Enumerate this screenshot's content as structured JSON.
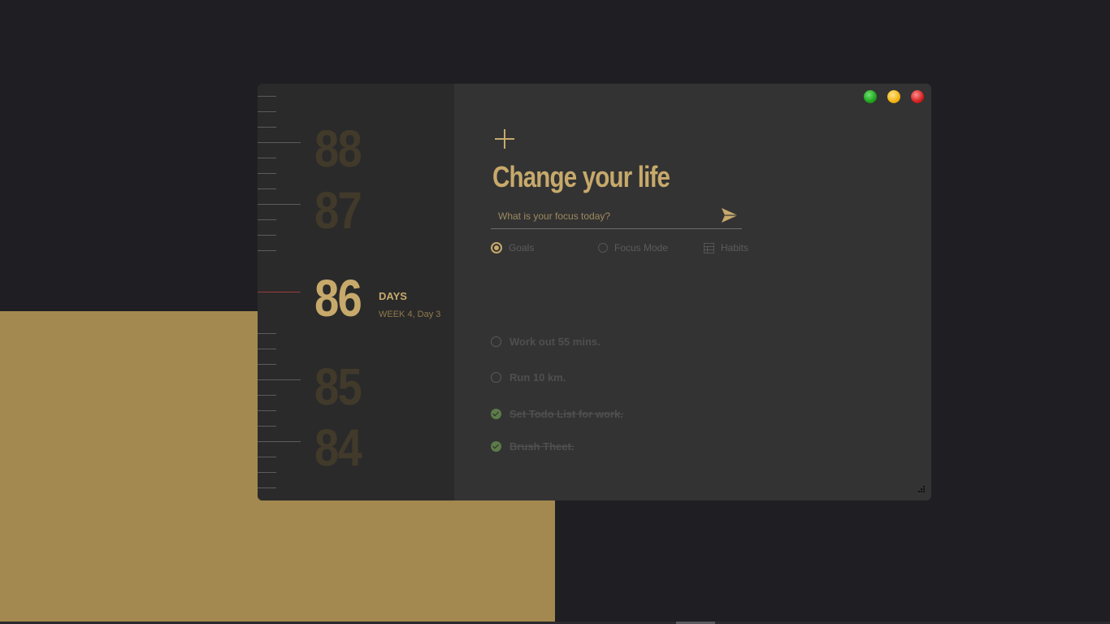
{
  "app": {
    "title": "Change your life",
    "window_controls": [
      "maximize",
      "minimize",
      "close"
    ]
  },
  "countdown": {
    "numbers": [
      "88",
      "87",
      "86",
      "85",
      "84"
    ],
    "current": "86",
    "unit_label": "DAYS",
    "week_label": "WEEK 4, Day 3"
  },
  "focus": {
    "placeholder": "What is your focus today?",
    "value": ""
  },
  "modes": [
    {
      "label": "Goals",
      "selected": true
    },
    {
      "label": "Focus Mode",
      "selected": false
    },
    {
      "label": "Habits",
      "selected": false
    }
  ],
  "tasks": [
    {
      "label": "Work out 55 mins.",
      "done": false
    },
    {
      "label": "Run 10 km.",
      "done": false
    },
    {
      "label": "Set Todo List for work.",
      "done": true
    },
    {
      "label": "Brush Theet.",
      "done": true
    }
  ],
  "colors": {
    "accent": "#c7a96b",
    "background": "#1f1f23",
    "panel": "#333333",
    "sidebar": "#2a2a2a",
    "desktop_block": "#a3884f"
  },
  "icons": {
    "add": "plus-icon",
    "send": "send-icon",
    "goals": "target-icon",
    "focus_mode": "circle-icon",
    "habits": "calendar-grid-icon",
    "resize": "resize-grip-icon"
  }
}
